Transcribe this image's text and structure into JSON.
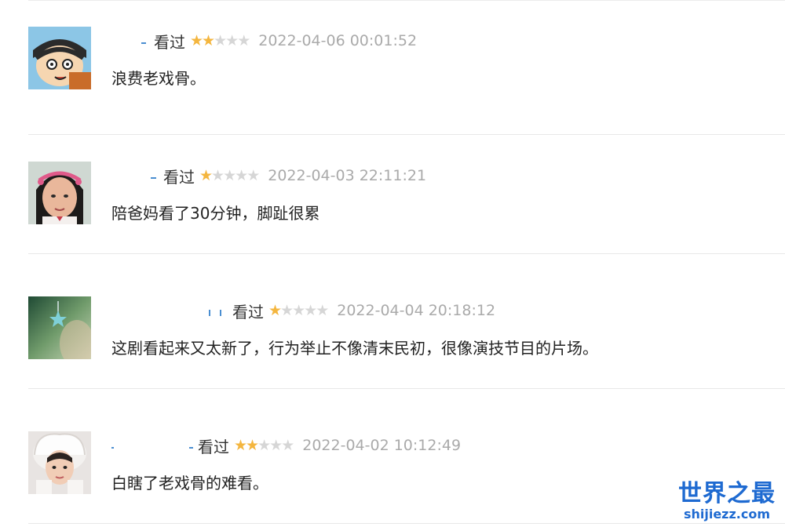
{
  "comments": [
    {
      "username": "",
      "status": "看过",
      "rating": 2,
      "max_rating": 5,
      "time": "2022-04-06 00:01:52",
      "content": "浪费老戏骨。",
      "avatar": "cartoon-boy-avatar"
    },
    {
      "username": "",
      "status": "看过",
      "rating": 1,
      "max_rating": 5,
      "time": "2022-04-03 22:11:21",
      "content": "陪爸妈看了30分钟，脚趾很累",
      "avatar": "person-pink-headband-avatar"
    },
    {
      "username": "",
      "status": "看过",
      "rating": 1,
      "max_rating": 5,
      "time": "2022-04-04 20:18:12",
      "content": "这剧看起来又太新了，行为举止不像清末民初，很像演技节目的片场。",
      "avatar": "star-earring-avatar"
    },
    {
      "username": "",
      "status": "看过",
      "rating": 2,
      "max_rating": 5,
      "time": "2022-04-02 10:12:49",
      "content": "白瞎了老戏骨的难看。",
      "avatar": "person-fur-hood-avatar"
    }
  ],
  "watermark": {
    "title": "世界之最",
    "url": "shijiezz.com"
  },
  "colors": {
    "star_on": "#f4b63f",
    "star_off": "#d6d6d6",
    "username": "#3377aa",
    "watermark": "#1e6ad1"
  }
}
